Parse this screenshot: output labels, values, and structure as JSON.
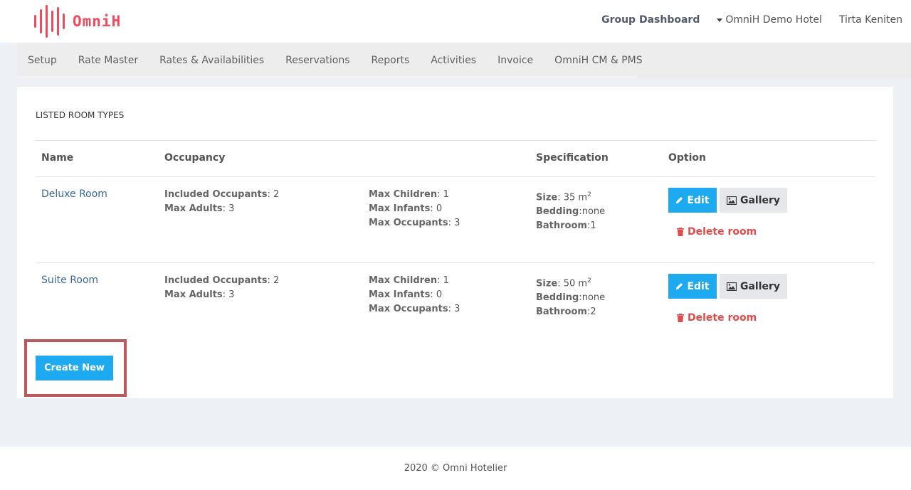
{
  "brand": {
    "name": "OmniH",
    "color": "#ef4b5f"
  },
  "header": {
    "group_dashboard": "Group Dashboard",
    "hotel": "OmniH Demo Hotel",
    "user": "Tirta Keniten"
  },
  "nav": {
    "items": [
      {
        "label": "Setup"
      },
      {
        "label": "Rate Master"
      },
      {
        "label": "Rates & Availabilities"
      },
      {
        "label": "Reservations"
      },
      {
        "label": "Reports"
      },
      {
        "label": "Activities"
      },
      {
        "label": "Invoice"
      },
      {
        "label": "OmniH CM & PMS"
      }
    ]
  },
  "main": {
    "title": "LISTED ROOM TYPES",
    "columns": {
      "name": "Name",
      "occupancy": "Occupancy",
      "specification": "Specification",
      "option": "Option"
    },
    "labels": {
      "included_occupants": "Included Occupants",
      "max_adults": "Max Adults",
      "max_children": "Max Children",
      "max_infants": "Max Infants",
      "max_occupants": "Max Occupants",
      "size": "Size",
      "bedding": "Bedding",
      "bathroom": "Bathroom",
      "size_unit": "m",
      "size_unit_exp": "2"
    },
    "rooms": [
      {
        "name": "Deluxe Room",
        "included_occupants": ": 2",
        "max_adults": ": 3",
        "max_children": ": 1",
        "max_infants": ": 0",
        "max_occupants": ": 3",
        "size": ": 35 ",
        "bedding": ":none",
        "bathroom": ":1"
      },
      {
        "name": "Suite Room",
        "included_occupants": ": 2",
        "max_adults": ": 3",
        "max_children": ": 1",
        "max_infants": ": 0",
        "max_occupants": ": 3",
        "size": ": 50 ",
        "bedding": ":none",
        "bathroom": ":2"
      }
    ],
    "buttons": {
      "edit": "Edit",
      "gallery": "Gallery",
      "delete": "Delete room",
      "create": "Create New"
    },
    "colors": {
      "primary": "#1eaaf1",
      "danger": "#e14b4b",
      "highlight": "#b9595c"
    }
  },
  "footer": {
    "text": "2020 © Omni Hotelier"
  }
}
